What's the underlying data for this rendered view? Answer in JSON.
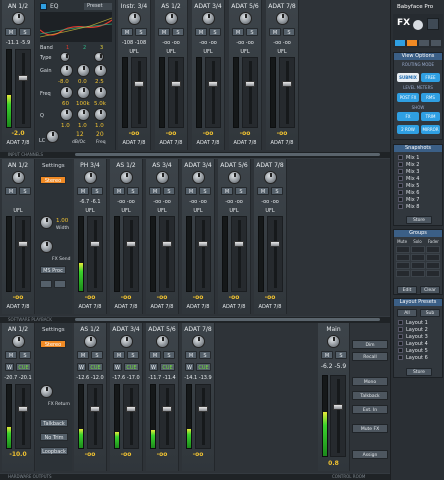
{
  "row1": {
    "strips": [
      {
        "name": "AN 1/2",
        "values": "-11.1  -5.9",
        "out": "ADAT 7/8",
        "vol": "-2.0",
        "level": 0.42
      },
      {
        "name": "Instr. 3/4",
        "values": "-108  -108",
        "out": "ADAT 7/8",
        "vol": "-oo",
        "level": 0
      },
      {
        "name": "AS 1/2",
        "values": "-oo  -oo",
        "out": "ADAT 7/8",
        "vol": "-oo",
        "level": 0
      },
      {
        "name": "ADAT 3/4",
        "values": "-oo  -oo",
        "out": "ADAT 7/8",
        "vol": "-oo",
        "level": 0
      },
      {
        "name": "ADAT 5/6",
        "values": "-oo  -oo",
        "out": "ADAT 7/8",
        "vol": "-oo",
        "level": 0
      },
      {
        "name": "ADAT 7/8",
        "values": "-oo  -oo",
        "out": "ADAT 7/8",
        "vol": "-oo",
        "level": 0
      }
    ],
    "eq": {
      "title": "EQ",
      "preset": "Preset",
      "bands_label": "Band",
      "band_nums": [
        "1",
        "2",
        "3"
      ],
      "type_label": "Type",
      "gain_label": "Gain",
      "freq_label": "Freq",
      "q_label": "Q",
      "gains": [
        "-8.0",
        "0.0",
        "2.5"
      ],
      "freqs": [
        "60",
        "100k",
        "5.0k"
      ],
      "qs": [
        "1.0",
        "1.0",
        "1.0"
      ],
      "lc_label": "LC",
      "lc_value": "12",
      "lc_unit": "dB/Oc",
      "freq2": "20",
      "freq2_label": "Freq"
    },
    "footer": "INPUT CHANNELS"
  },
  "row2": {
    "strips": [
      {
        "name": "AN 1/2",
        "values": "",
        "out": "ADAT 7/8",
        "vol": "-oo",
        "level": 0
      },
      {
        "name": "PH 3/4",
        "values": "-6.7  -6.1",
        "out": "ADAT 7/8",
        "vol": "-oo",
        "level": 0.38
      },
      {
        "name": "AS 1/2",
        "values": "-oo  -oo",
        "out": "ADAT 7/8",
        "vol": "-oo",
        "level": 0
      },
      {
        "name": "AS 3/4",
        "values": "-oo  -oo",
        "out": "ADAT 7/8",
        "vol": "-oo",
        "level": 0
      },
      {
        "name": "ADAT 3/4",
        "values": "-oo  -oo",
        "out": "ADAT 7/8",
        "vol": "-oo",
        "level": 0
      },
      {
        "name": "ADAT 5/6",
        "values": "-oo  -oo",
        "out": "ADAT 7/8",
        "vol": "-oo",
        "level": 0
      },
      {
        "name": "ADAT 7/8",
        "values": "-oo  -oo",
        "out": "ADAT 7/8",
        "vol": "-oo",
        "level": 0
      }
    ],
    "settings": "Settings",
    "stereo": "Stereo",
    "width_val": "1.00",
    "width_label": "Width",
    "fx_send": "FX Send",
    "ms_proc": "MS Proc",
    "footer": "SOFTWARE PLAYBACK"
  },
  "row3": {
    "strips": [
      {
        "name": "AN 1/2",
        "values": "-20.7  -20.1",
        "out": "",
        "vol": "-10.0",
        "level": 0.33
      },
      {
        "name": "AS 1/2",
        "values": "-12.6  -12.0",
        "out": "",
        "vol": "-oo",
        "level": 0.3
      },
      {
        "name": "ADAT 3/4",
        "values": "-17.6  -17.0",
        "out": "",
        "vol": "-oo",
        "level": 0.26
      },
      {
        "name": "ADAT 5/6",
        "values": "-11.7  -11.4",
        "out": "",
        "vol": "-oo",
        "level": 0.28
      },
      {
        "name": "ADAT 7/8",
        "values": "-14.1  -13.9",
        "out": "",
        "vol": "-oo",
        "level": 0.3
      }
    ],
    "settings": "Settings",
    "stereo": "Stereo",
    "fx_return": "FX Return",
    "talkback": "Talkback",
    "no_trim": "No Trim",
    "loopback": "Loopback",
    "footer": "HARDWARE OUTPUTS",
    "main": {
      "name": "Main",
      "values": "-6.2  -5.9",
      "vol": "0.8",
      "level": 0.55
    },
    "main_buttons": [
      "Dim",
      "Recall",
      "",
      "Mono",
      "Talkback",
      "Ext. In",
      "Mute FX",
      "",
      "Assign"
    ],
    "control_room": "CONTROL ROOM"
  },
  "side": {
    "title": "Babyface Pro",
    "fx_label": "FX",
    "view_options": "View Options",
    "routing_mode": "ROUTING MODE",
    "submix": "SUBMIX",
    "free": "FREE",
    "level_meters": "LEVEL METERS",
    "post_fx": "POST FX",
    "rms": "RMS",
    "show": "SHOW",
    "fx": "FX",
    "trim": "TRIM",
    "two_row": "2 ROW",
    "mirror": "MIRROR",
    "snapshots": "Snapshots",
    "mixes": [
      "Mix 1",
      "Mix 2",
      "Mix 3",
      "Mix 4",
      "Mix 5",
      "Mix 6",
      "Mix 7",
      "Mix 8"
    ],
    "store": "Store",
    "groups": "Groups",
    "group_cols": [
      "Mute",
      "Solo",
      "Fader"
    ],
    "edit": "Edit",
    "clear": "Clear",
    "layout_presets": "Layout Presets",
    "all": "All",
    "sub": "Sub",
    "layouts": [
      "Layout 1",
      "Layout 2",
      "Layout 3",
      "Layout 4",
      "Layout 5",
      "Layout 6"
    ],
    "store2": "Store"
  },
  "common": {
    "m": "M",
    "s": "S",
    "w": "W",
    "cue": "CUE",
    "ufl": "UFL"
  },
  "colors": {
    "meter": "#3bd22c",
    "accent": "#f08a24",
    "blue": "#2f9fe2",
    "vol": "#f3c431"
  }
}
